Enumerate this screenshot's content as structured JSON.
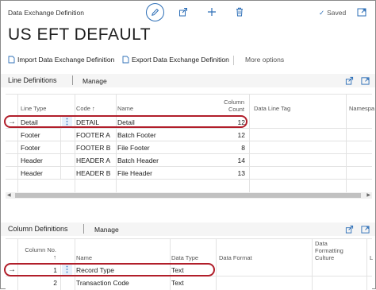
{
  "header": {
    "page_kind": "Data Exchange Definition",
    "saved_label": "Saved",
    "icons": [
      "edit-icon",
      "share-icon",
      "add-icon",
      "delete-icon",
      "expand-icon"
    ]
  },
  "title": "US EFT DEFAULT",
  "actions": {
    "import": "Import Data Exchange Definition",
    "export": "Export Data Exchange Definition",
    "more": "More options"
  },
  "line_definitions": {
    "title": "Line Definitions",
    "manage": "Manage",
    "columns": {
      "line_type": "Line Type",
      "code": "Code",
      "code_sort": "↑",
      "name": "Name",
      "column_count_1": "Column",
      "column_count_2": "Count",
      "data_line_tag": "Data Line Tag",
      "namespace": "Namespa"
    },
    "rows": [
      {
        "line_type": "Detail",
        "code": "DETAIL",
        "name": "Detail",
        "count": "12"
      },
      {
        "line_type": "Footer",
        "code": "FOOTER A",
        "name": "Batch Footer",
        "count": "12"
      },
      {
        "line_type": "Footer",
        "code": "FOOTER B",
        "name": "File Footer",
        "count": "8"
      },
      {
        "line_type": "Header",
        "code": "HEADER A",
        "name": "Batch Header",
        "count": "14"
      },
      {
        "line_type": "Header",
        "code": "HEADER B",
        "name": "File Header",
        "count": "13"
      }
    ]
  },
  "column_definitions": {
    "title": "Column Definitions",
    "manage": "Manage",
    "columns": {
      "column_no": "Column No.",
      "column_no_sort": "↑",
      "name": "Name",
      "data_type": "Data Type",
      "data_format": "Data Format",
      "dfc_1": "Data",
      "dfc_2": "Formatting",
      "dfc_3": "Culture",
      "len": "L"
    },
    "rows": [
      {
        "no": "1",
        "name": "Record Type",
        "data_type": "Text"
      },
      {
        "no": "2",
        "name": "Transaction Code",
        "data_type": "Text"
      }
    ]
  },
  "colors": {
    "accent": "#2e6fb7",
    "highlight": "#b11e2a"
  }
}
